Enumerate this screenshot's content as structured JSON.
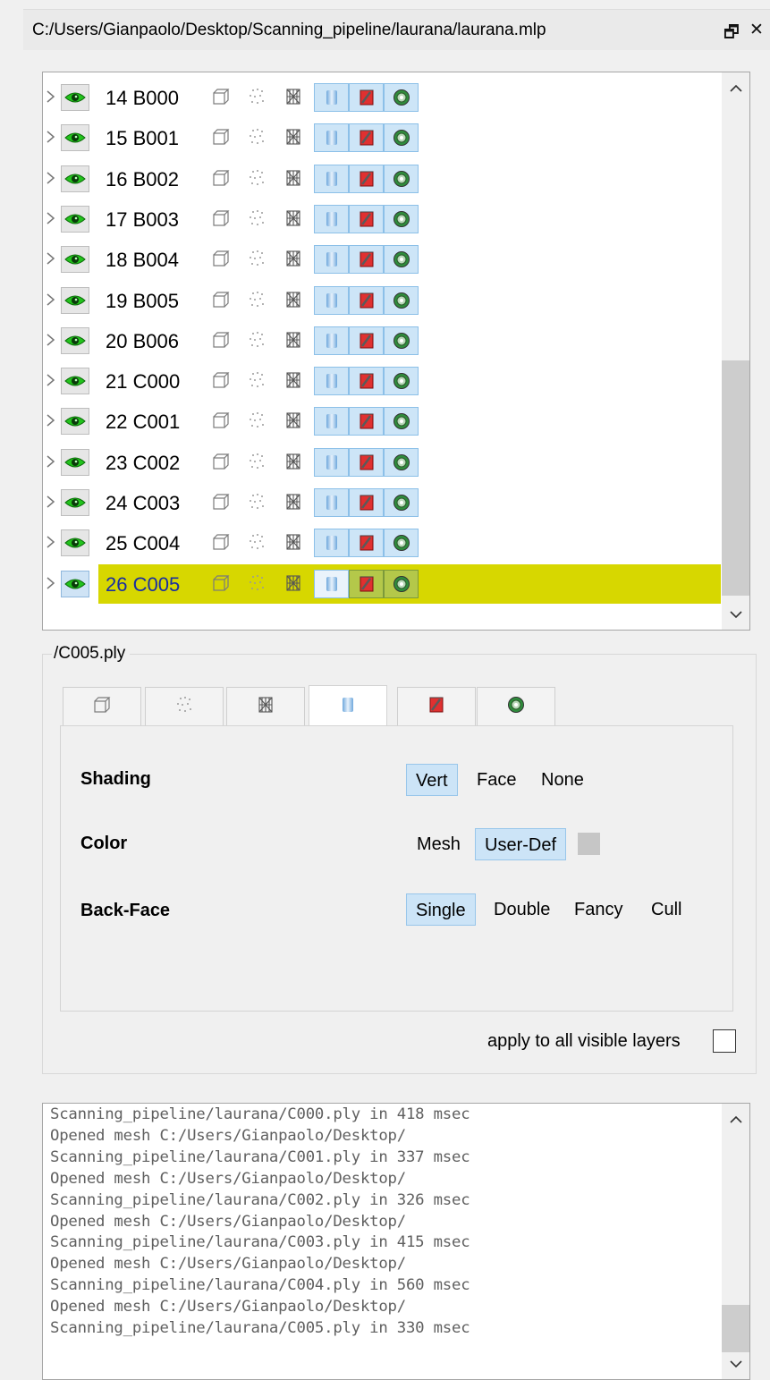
{
  "window": {
    "path": "C:/Users/Gianpaolo/Desktop/Scanning_pipeline/laurana/laurana.mlp",
    "float_glyph": "🗗",
    "close_glyph": "✕"
  },
  "layers": [
    {
      "label": "14 B000",
      "selected": false
    },
    {
      "label": "15 B001",
      "selected": false
    },
    {
      "label": "16 B002",
      "selected": false
    },
    {
      "label": "17 B003",
      "selected": false
    },
    {
      "label": "18 B004",
      "selected": false
    },
    {
      "label": "19 B005",
      "selected": false
    },
    {
      "label": "20 B006",
      "selected": false
    },
    {
      "label": "21 C000",
      "selected": false
    },
    {
      "label": "22 C001",
      "selected": false
    },
    {
      "label": "23 C002",
      "selected": false
    },
    {
      "label": "24 C003",
      "selected": false
    },
    {
      "label": "25 C004",
      "selected": false
    },
    {
      "label": "26 C005",
      "selected": true
    }
  ],
  "render": {
    "group_title": "/C005.ply",
    "tabs": [
      "box-icon",
      "points-icon",
      "wireframe-icon",
      "solid-icon",
      "texture-icon",
      "dots-mesh-icon"
    ],
    "active_tab": 3,
    "shading": {
      "label": "Shading",
      "options": [
        "Vert",
        "Face",
        "None"
      ],
      "active": "Vert"
    },
    "color": {
      "label": "Color",
      "options": [
        "Mesh",
        "User-Def"
      ],
      "active": "User-Def",
      "swatch": "#c6c6c6"
    },
    "backface": {
      "label": "Back-Face",
      "options": [
        "Single",
        "Double",
        "Fancy",
        "Cull"
      ],
      "active": "Single"
    },
    "apply_label": "apply to all visible layers",
    "apply_checked": false
  },
  "colors": {
    "selected_row": "#d7d700",
    "toggle_on": "#cde5f7",
    "eye_green": "#22c31c"
  },
  "log": {
    "lines": [
      "Scanning_pipeline/laurana/C000.ply in 418 msec",
      "Opened mesh C:/Users/Gianpaolo/Desktop/",
      "Scanning_pipeline/laurana/C001.ply in 337 msec",
      "Opened mesh C:/Users/Gianpaolo/Desktop/",
      "Scanning_pipeline/laurana/C002.ply in 326 msec",
      "Opened mesh C:/Users/Gianpaolo/Desktop/",
      "Scanning_pipeline/laurana/C003.ply in 415 msec",
      "Opened mesh C:/Users/Gianpaolo/Desktop/",
      "Scanning_pipeline/laurana/C004.ply in 560 msec",
      "Opened mesh C:/Users/Gianpaolo/Desktop/",
      "Scanning_pipeline/laurana/C005.ply in 330 msec"
    ]
  }
}
